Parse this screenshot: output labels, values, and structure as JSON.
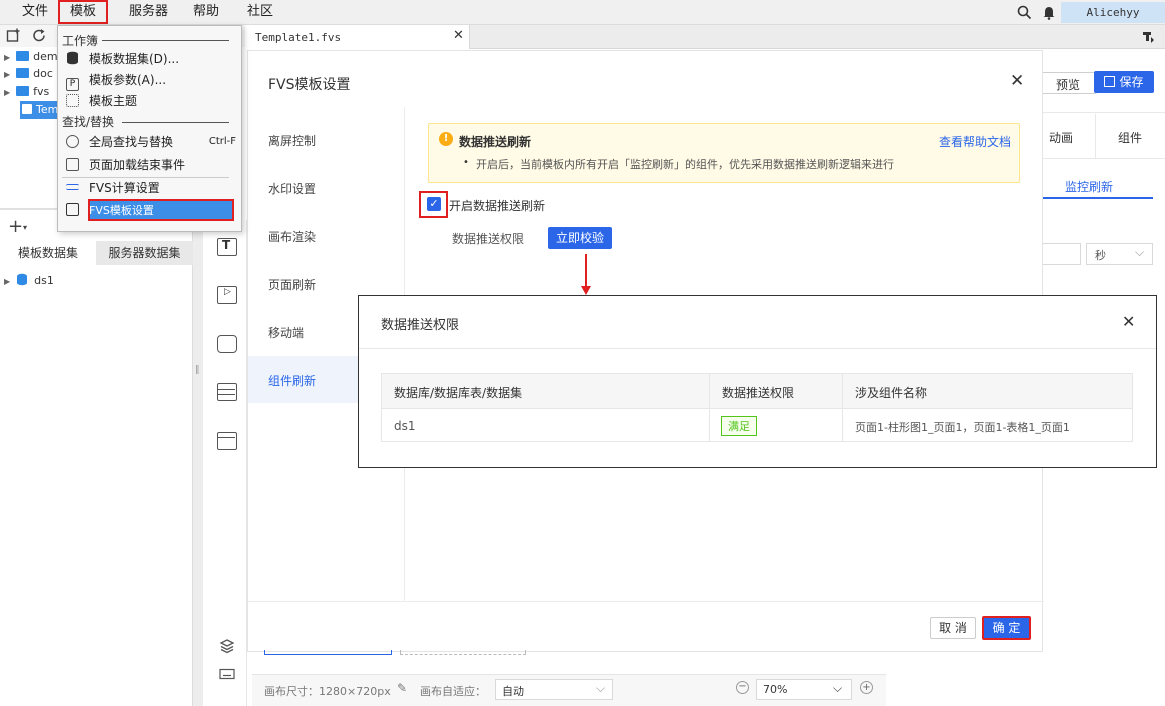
{
  "menubar": {
    "file": "文件",
    "template": "模板",
    "server": "服务器",
    "help": "帮助",
    "community": "社区",
    "user": "Alicehyy"
  },
  "tab": {
    "title": "Template1.fvs"
  },
  "tree": {
    "items": [
      "dem",
      "doc",
      "fvs",
      "Tem"
    ],
    "ds": "ds1"
  },
  "dataset_tabs": {
    "template": "模板数据集",
    "server": "服务器数据集"
  },
  "toolbar_right": {
    "preview": "预览",
    "save": "保存"
  },
  "side_tabs": {
    "animation": "动画",
    "component": "组件",
    "monitor": "监控刷新",
    "unit": "秒"
  },
  "dialog": {
    "title": "FVS模板设置",
    "nav": [
      "离屏控制",
      "水印设置",
      "画布渲染",
      "页面刷新",
      "移动端",
      "组件刷新"
    ],
    "hint_title": "数据推送刷新",
    "hint_link": "查看帮助文档",
    "hint_text": "开启后，当前模板内所有开启「监控刷新」的组件，优先采用数据推送刷新逻辑来进行",
    "checkbox_label": "开启数据推送刷新",
    "permission_label": "数据推送权限",
    "verify_button": "立即校验",
    "cancel": "取 消",
    "confirm": "确 定"
  },
  "popup": {
    "title": "数据推送权限",
    "headers": [
      "数据库/数据库表/数据集",
      "数据推送权限",
      "涉及组件名称"
    ],
    "row": {
      "dataset": "ds1",
      "status": "满足",
      "components": "页面1-柱形图1_页面1，页面1-表格1_页面1"
    }
  },
  "menu": {
    "section_workbook": "工作簿",
    "dataset": "模板数据集(D)...",
    "params": "模板参数(A)...",
    "theme": "模板主题",
    "section_find": "查找/替换",
    "find_replace": "全局查找与替换",
    "shortcut": "Ctrl-F",
    "load_event": "页面加载结束事件",
    "calc": "FVS计算设置",
    "fvs_settings": "FVS模板设置"
  },
  "statusbar": {
    "canvas_size": "画布尺寸：1280×720px",
    "adaptive_label": "画布自适应：",
    "adaptive_value": "自动",
    "zoom": "70%"
  },
  "colors": {
    "accent": "#2b66e8",
    "highlight": "#e02020",
    "hint_bg": "#fffbe6",
    "ok_green": "#52c41a"
  }
}
